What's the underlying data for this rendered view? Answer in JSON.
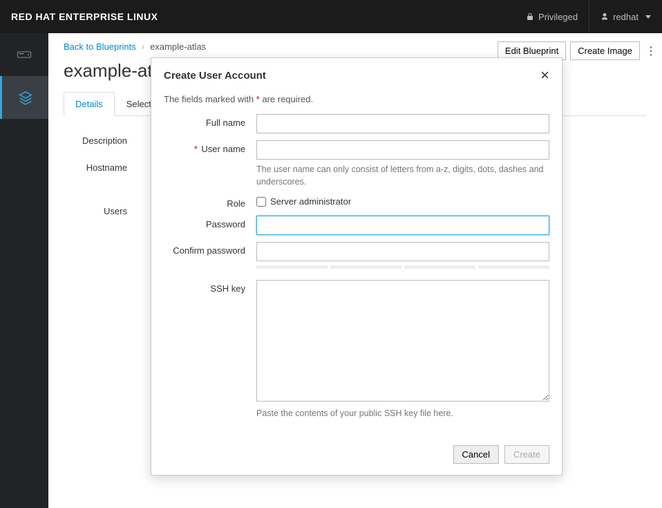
{
  "topbar": {
    "title": "RED HAT ENTERPRISE LINUX",
    "privileged_label": "Privileged",
    "username": "redhat"
  },
  "breadcrumb": {
    "back_label": "Back to Blueprints",
    "current": "example-atlas"
  },
  "actions": {
    "edit_blueprint": "Edit Blueprint",
    "create_image": "Create Image"
  },
  "page": {
    "title": "example-atlas"
  },
  "tabs": {
    "details": "Details",
    "selected": "Selected Components"
  },
  "details": {
    "description_label": "Description",
    "hostname_label": "Hostname",
    "users_label": "Users"
  },
  "modal": {
    "title": "Create User Account",
    "required_prefix": "The fields marked with ",
    "required_suffix": " are required.",
    "labels": {
      "full_name": "Full name",
      "user_name": "User name",
      "role": "Role",
      "password": "Password",
      "confirm_password": "Confirm password",
      "ssh_key": "SSH key"
    },
    "hints": {
      "user_name": "The user name can only consist of letters from a-z, digits, dots, dashes and underscores.",
      "ssh_key": "Paste the contents of your public SSH key file here."
    },
    "role_checkbox_label": "Server administrator",
    "footer": {
      "cancel": "Cancel",
      "create": "Create"
    }
  }
}
